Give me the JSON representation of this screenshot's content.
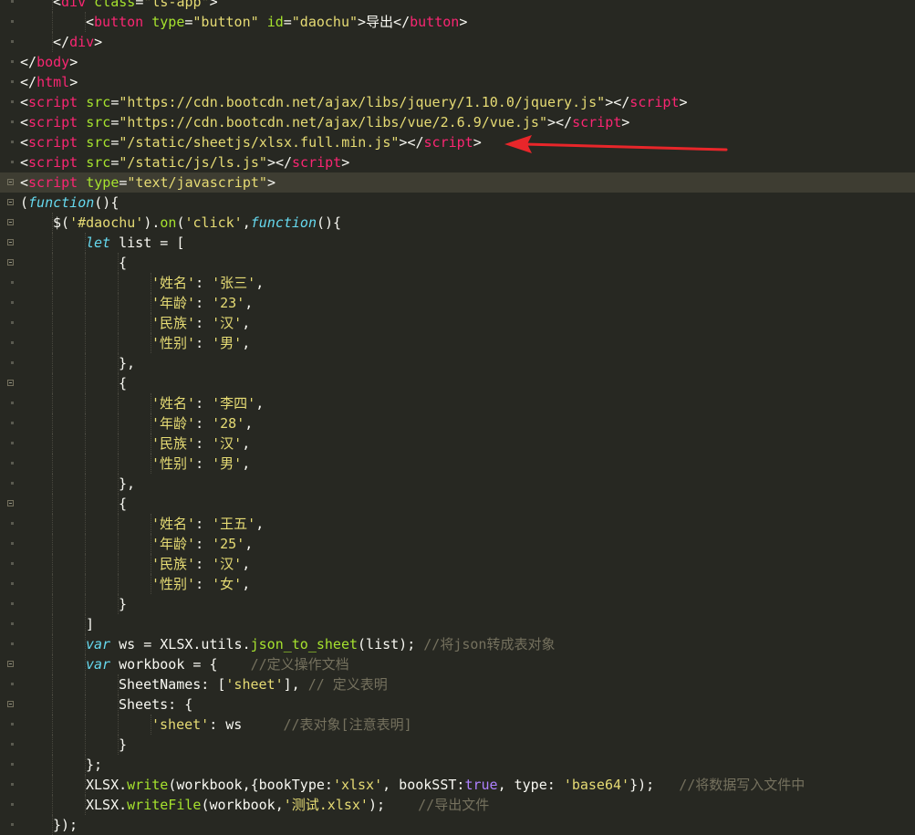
{
  "editor": {
    "language": "html",
    "theme_colors": {
      "background": "#272822",
      "tag": "#f92672",
      "attribute": "#a6e22e",
      "string": "#e6db74",
      "keyword": "#66d9ef",
      "function": "#a6e22e",
      "constant": "#ae81ff",
      "comment": "#75715e",
      "text": "#f8f8f2",
      "arrow": "#e8262a"
    },
    "lines": [
      {
        "indent": 1,
        "fold": false,
        "tokens": [
          [
            "pl",
            "<"
          ],
          [
            "tag",
            "div"
          ],
          [
            "pl",
            " "
          ],
          [
            "attr",
            "class"
          ],
          [
            "pl",
            "="
          ],
          [
            "str",
            "\"ls-app\""
          ],
          [
            "pl",
            ">"
          ]
        ]
      },
      {
        "indent": 2,
        "fold": false,
        "tokens": [
          [
            "pl",
            "<"
          ],
          [
            "tag",
            "button"
          ],
          [
            "pl",
            " "
          ],
          [
            "attr",
            "type"
          ],
          [
            "pl",
            "="
          ],
          [
            "str",
            "\"button\""
          ],
          [
            "pl",
            " "
          ],
          [
            "attr",
            "id"
          ],
          [
            "pl",
            "="
          ],
          [
            "str",
            "\"daochu\""
          ],
          [
            "pl",
            ">导出</"
          ],
          [
            "tag",
            "button"
          ],
          [
            "pl",
            ">"
          ]
        ]
      },
      {
        "indent": 1,
        "fold": false,
        "tokens": [
          [
            "pl",
            "</"
          ],
          [
            "tag",
            "div"
          ],
          [
            "pl",
            ">"
          ]
        ]
      },
      {
        "indent": 0,
        "fold": false,
        "tokens": [
          [
            "pl",
            "</"
          ],
          [
            "tag",
            "body"
          ],
          [
            "pl",
            ">"
          ]
        ]
      },
      {
        "indent": 0,
        "fold": false,
        "tokens": [
          [
            "pl",
            "</"
          ],
          [
            "tag",
            "html"
          ],
          [
            "pl",
            ">"
          ]
        ]
      },
      {
        "indent": 0,
        "fold": false,
        "tokens": [
          [
            "pl",
            "<"
          ],
          [
            "tag",
            "script"
          ],
          [
            "pl",
            " "
          ],
          [
            "attr",
            "src"
          ],
          [
            "pl",
            "="
          ],
          [
            "str",
            "\"https://cdn.bootcdn.net/ajax/libs/jquery/1.10.0/jquery.js\""
          ],
          [
            "pl",
            "></"
          ],
          [
            "tag",
            "script"
          ],
          [
            "pl",
            ">"
          ]
        ]
      },
      {
        "indent": 0,
        "fold": false,
        "tokens": [
          [
            "pl",
            "<"
          ],
          [
            "tag",
            "script"
          ],
          [
            "pl",
            " "
          ],
          [
            "attr",
            "src"
          ],
          [
            "pl",
            "="
          ],
          [
            "str",
            "\"https://cdn.bootcdn.net/ajax/libs/vue/2.6.9/vue.js\""
          ],
          [
            "pl",
            "></"
          ],
          [
            "tag",
            "script"
          ],
          [
            "pl",
            ">"
          ]
        ]
      },
      {
        "indent": 0,
        "fold": false,
        "tokens": [
          [
            "pl",
            "<"
          ],
          [
            "tag",
            "script"
          ],
          [
            "pl",
            " "
          ],
          [
            "attr",
            "src"
          ],
          [
            "pl",
            "="
          ],
          [
            "str",
            "\"/static/sheetjs/xlsx.full.min.js\""
          ],
          [
            "pl",
            "></"
          ],
          [
            "tag",
            "script"
          ],
          [
            "pl",
            ">"
          ]
        ]
      },
      {
        "indent": 0,
        "fold": false,
        "tokens": [
          [
            "pl",
            "<"
          ],
          [
            "tag",
            "script"
          ],
          [
            "pl",
            " "
          ],
          [
            "attr",
            "src"
          ],
          [
            "pl",
            "="
          ],
          [
            "str",
            "\"/static/js/ls.js\""
          ],
          [
            "pl",
            "></"
          ],
          [
            "tag",
            "script"
          ],
          [
            "pl",
            ">"
          ]
        ]
      },
      {
        "indent": 0,
        "fold": true,
        "active": true,
        "tokens": [
          [
            "pl",
            "<"
          ],
          [
            "tag",
            "script"
          ],
          [
            "pl",
            " "
          ],
          [
            "attr",
            "type"
          ],
          [
            "pl",
            "="
          ],
          [
            "str",
            "\"text/javascript\""
          ],
          [
            "pl",
            ">"
          ]
        ]
      },
      {
        "indent": 0,
        "fold": true,
        "tokens": [
          [
            "pl",
            "("
          ],
          [
            "kw",
            "function"
          ],
          [
            "pl",
            "(){"
          ]
        ]
      },
      {
        "indent": 1,
        "fold": true,
        "tokens": [
          [
            "pl",
            "$("
          ],
          [
            "str",
            "'#daochu'"
          ],
          [
            "pl",
            ")."
          ],
          [
            "fn",
            "on"
          ],
          [
            "pl",
            "("
          ],
          [
            "str",
            "'click'"
          ],
          [
            "pl",
            ","
          ],
          [
            "kw",
            "function"
          ],
          [
            "pl",
            "(){"
          ]
        ]
      },
      {
        "indent": 2,
        "fold": true,
        "tokens": [
          [
            "kw",
            "let"
          ],
          [
            "pl",
            " list = ["
          ]
        ]
      },
      {
        "indent": 3,
        "fold": true,
        "tokens": [
          [
            "pl",
            "{"
          ]
        ]
      },
      {
        "indent": 4,
        "fold": false,
        "tokens": [
          [
            "str",
            "'姓名'"
          ],
          [
            "pl",
            ": "
          ],
          [
            "str",
            "'张三'"
          ],
          [
            "pl",
            ","
          ]
        ]
      },
      {
        "indent": 4,
        "fold": false,
        "tokens": [
          [
            "str",
            "'年龄'"
          ],
          [
            "pl",
            ": "
          ],
          [
            "str",
            "'23'"
          ],
          [
            "pl",
            ","
          ]
        ]
      },
      {
        "indent": 4,
        "fold": false,
        "tokens": [
          [
            "str",
            "'民族'"
          ],
          [
            "pl",
            ": "
          ],
          [
            "str",
            "'汉'"
          ],
          [
            "pl",
            ","
          ]
        ]
      },
      {
        "indent": 4,
        "fold": false,
        "tokens": [
          [
            "str",
            "'性别'"
          ],
          [
            "pl",
            ": "
          ],
          [
            "str",
            "'男'"
          ],
          [
            "pl",
            ","
          ]
        ]
      },
      {
        "indent": 3,
        "fold": false,
        "tokens": [
          [
            "pl",
            "},"
          ]
        ]
      },
      {
        "indent": 3,
        "fold": true,
        "tokens": [
          [
            "pl",
            "{"
          ]
        ]
      },
      {
        "indent": 4,
        "fold": false,
        "tokens": [
          [
            "str",
            "'姓名'"
          ],
          [
            "pl",
            ": "
          ],
          [
            "str",
            "'李四'"
          ],
          [
            "pl",
            ","
          ]
        ]
      },
      {
        "indent": 4,
        "fold": false,
        "tokens": [
          [
            "str",
            "'年龄'"
          ],
          [
            "pl",
            ": "
          ],
          [
            "str",
            "'28'"
          ],
          [
            "pl",
            ","
          ]
        ]
      },
      {
        "indent": 4,
        "fold": false,
        "tokens": [
          [
            "str",
            "'民族'"
          ],
          [
            "pl",
            ": "
          ],
          [
            "str",
            "'汉'"
          ],
          [
            "pl",
            ","
          ]
        ]
      },
      {
        "indent": 4,
        "fold": false,
        "tokens": [
          [
            "str",
            "'性别'"
          ],
          [
            "pl",
            ": "
          ],
          [
            "str",
            "'男'"
          ],
          [
            "pl",
            ","
          ]
        ]
      },
      {
        "indent": 3,
        "fold": false,
        "tokens": [
          [
            "pl",
            "},"
          ]
        ]
      },
      {
        "indent": 3,
        "fold": true,
        "tokens": [
          [
            "pl",
            "{"
          ]
        ]
      },
      {
        "indent": 4,
        "fold": false,
        "tokens": [
          [
            "str",
            "'姓名'"
          ],
          [
            "pl",
            ": "
          ],
          [
            "str",
            "'王五'"
          ],
          [
            "pl",
            ","
          ]
        ]
      },
      {
        "indent": 4,
        "fold": false,
        "tokens": [
          [
            "str",
            "'年龄'"
          ],
          [
            "pl",
            ": "
          ],
          [
            "str",
            "'25'"
          ],
          [
            "pl",
            ","
          ]
        ]
      },
      {
        "indent": 4,
        "fold": false,
        "tokens": [
          [
            "str",
            "'民族'"
          ],
          [
            "pl",
            ": "
          ],
          [
            "str",
            "'汉'"
          ],
          [
            "pl",
            ","
          ]
        ]
      },
      {
        "indent": 4,
        "fold": false,
        "tokens": [
          [
            "str",
            "'性别'"
          ],
          [
            "pl",
            ": "
          ],
          [
            "str",
            "'女'"
          ],
          [
            "pl",
            ","
          ]
        ]
      },
      {
        "indent": 3,
        "fold": false,
        "tokens": [
          [
            "pl",
            "}"
          ]
        ]
      },
      {
        "indent": 2,
        "fold": false,
        "tokens": [
          [
            "pl",
            "]"
          ]
        ]
      },
      {
        "indent": 2,
        "fold": false,
        "tokens": [
          [
            "kw",
            "var"
          ],
          [
            "pl",
            " ws = XLSX.utils."
          ],
          [
            "fn",
            "json_to_sheet"
          ],
          [
            "pl",
            "(list); "
          ],
          [
            "cm",
            "//将json转成表对象"
          ]
        ]
      },
      {
        "indent": 2,
        "fold": true,
        "tokens": [
          [
            "kw",
            "var"
          ],
          [
            "pl",
            " workbook = {    "
          ],
          [
            "cm",
            "//定义操作文档"
          ]
        ]
      },
      {
        "indent": 3,
        "fold": false,
        "tokens": [
          [
            "pl",
            "SheetNames: ["
          ],
          [
            "str",
            "'sheet'"
          ],
          [
            "pl",
            "], "
          ],
          [
            "cm",
            "// 定义表明"
          ]
        ]
      },
      {
        "indent": 3,
        "fold": true,
        "tokens": [
          [
            "pl",
            "Sheets: {"
          ]
        ]
      },
      {
        "indent": 4,
        "fold": false,
        "tokens": [
          [
            "str",
            "'sheet'"
          ],
          [
            "pl",
            ": ws     "
          ],
          [
            "cm",
            "//表对象[注意表明]"
          ]
        ]
      },
      {
        "indent": 3,
        "fold": false,
        "tokens": [
          [
            "pl",
            "}"
          ]
        ]
      },
      {
        "indent": 2,
        "fold": false,
        "tokens": [
          [
            "pl",
            "};"
          ]
        ]
      },
      {
        "indent": 2,
        "fold": false,
        "tokens": [
          [
            "pl",
            "XLSX."
          ],
          [
            "fn",
            "write"
          ],
          [
            "pl",
            "(workbook,{bookType:"
          ],
          [
            "str",
            "'xlsx'"
          ],
          [
            "pl",
            ", bookSST:"
          ],
          [
            "con",
            "true"
          ],
          [
            "pl",
            ", type: "
          ],
          [
            "str",
            "'base64'"
          ],
          [
            "pl",
            "});   "
          ],
          [
            "cm",
            "//将数据写入文件中"
          ]
        ]
      },
      {
        "indent": 2,
        "fold": false,
        "tokens": [
          [
            "pl",
            "XLSX."
          ],
          [
            "fn",
            "writeFile"
          ],
          [
            "pl",
            "(workbook,"
          ],
          [
            "str",
            "'测试.xlsx'"
          ],
          [
            "pl",
            ");    "
          ],
          [
            "cm",
            "//导出文件"
          ]
        ]
      },
      {
        "indent": 1,
        "fold": false,
        "tokens": [
          [
            "pl",
            "});"
          ]
        ]
      }
    ]
  }
}
